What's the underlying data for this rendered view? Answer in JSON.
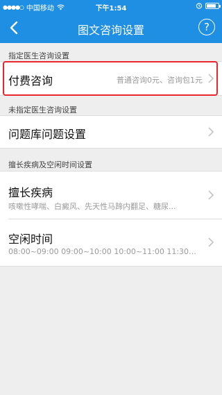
{
  "status_bar": {
    "carrier": "中国移动",
    "time": "下午1:54",
    "battery_level": 0.8
  },
  "nav": {
    "title": "图文咨询设置",
    "help_label": "?",
    "icons": {
      "back": "back-chevron-icon",
      "help": "help-circle-icon"
    }
  },
  "sections": {
    "designated": {
      "header": "指定医生咨询设置",
      "paid_label": "付费咨询",
      "paid_value": "普通咨询0元、咨询包1元"
    },
    "undesignated": {
      "header": "未指定医生咨询设置",
      "qbank_label": "问题库问题设置"
    },
    "specialty": {
      "header": "擅长疾病及空闲时间设置",
      "disease_label": "擅长疾病",
      "disease_value": "咳嗽性哮喘、白癜风、先天性马蹄内翻足、糖尿...",
      "free_time_label": "空闲时间",
      "free_time_value": "08:00~09:00  09:00~10:00  10:00~11:00  11:30~1..."
    }
  },
  "colors": {
    "brand_blue": "#1e8fe3",
    "highlight_red": "#e8262b",
    "background": "#eeeeee"
  }
}
